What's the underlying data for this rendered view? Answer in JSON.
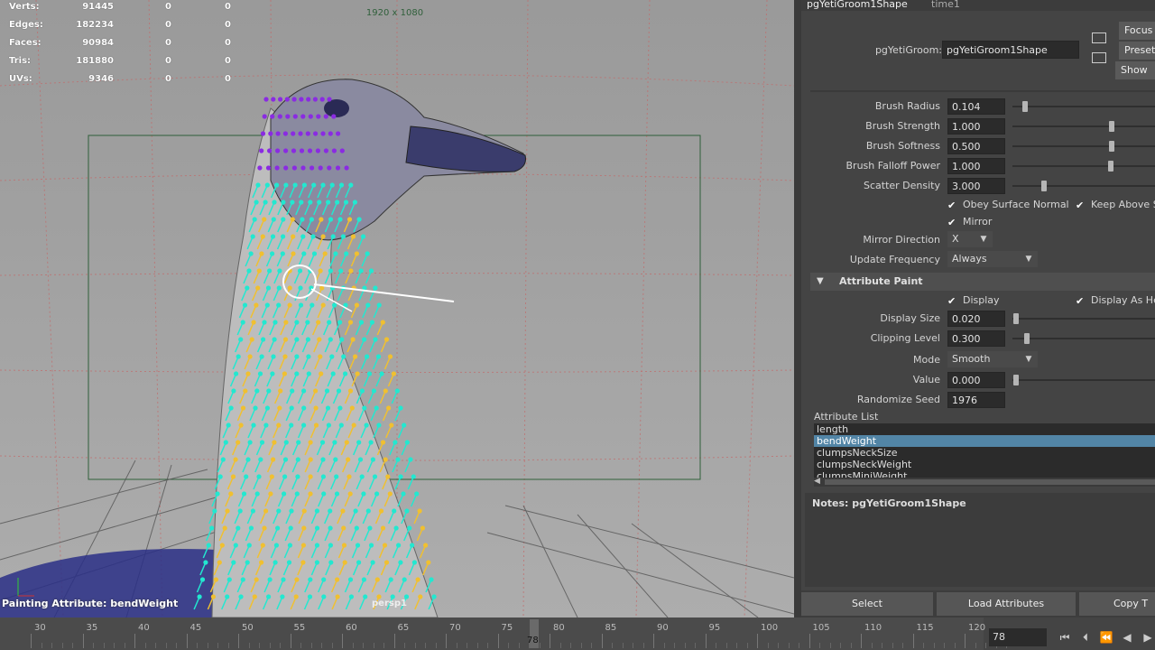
{
  "viewport": {
    "stats": [
      {
        "label": "Verts:",
        "v1": "91445",
        "v2": "0",
        "v3": "0"
      },
      {
        "label": "Edges:",
        "v1": "182234",
        "v2": "0",
        "v3": "0"
      },
      {
        "label": "Faces:",
        "v1": "90984",
        "v2": "0",
        "v3": "0"
      },
      {
        "label": "Tris:",
        "v1": "181880",
        "v2": "0",
        "v3": "0"
      },
      {
        "label": "UVs:",
        "v1": "9346",
        "v2": "0",
        "v3": "0"
      }
    ],
    "resolution": "1920 x 1080",
    "paint_status": "Painting Attribute: bendWeight",
    "camera": "persp1"
  },
  "panel": {
    "tabs": [
      "pgYetiGroom1Shape",
      "time1"
    ],
    "groom_label": "pgYetiGroom:",
    "groom_value": "pgYetiGroom1Shape",
    "side_buttons": [
      "Focus",
      "Presets",
      "Show"
    ],
    "brush": {
      "radius_label": "Brush Radius",
      "radius": "0.104",
      "strength_label": "Brush Strength",
      "strength": "1.000",
      "softness_label": "Brush Softness",
      "softness": "0.500",
      "falloff_label": "Brush Falloff Power",
      "falloff": "1.000",
      "scatter_label": "Scatter Density",
      "scatter": "3.000"
    },
    "obey_surface": "Obey Surface Normal",
    "keep_above": "Keep Above S",
    "mirror": "Mirror",
    "mirror_dir_label": "Mirror Direction",
    "mirror_dir": "X",
    "update_freq_label": "Update Frequency",
    "update_freq": "Always",
    "section_title": "Attribute Paint",
    "display": "Display",
    "display_as": "Display As He",
    "display_size_label": "Display Size",
    "display_size": "0.020",
    "clipping_label": "Clipping Level",
    "clipping": "0.300",
    "mode_label": "Mode",
    "mode": "Smooth",
    "value_label": "Value",
    "value": "0.000",
    "seed_label": "Randomize Seed",
    "seed": "1976",
    "attr_list_label": "Attribute List",
    "attr_list": [
      "length",
      "bendWeight",
      "clumpsNeckSize",
      "clumpsNeckWeight",
      "clumpsMiniWeight"
    ],
    "notes_label": "Notes:",
    "notes_value": "pgYetiGroom1Shape",
    "buttons": [
      "Select",
      "Load Attributes",
      "Copy T"
    ]
  },
  "timeline": {
    "ticks": [
      "30",
      "35",
      "40",
      "45",
      "50",
      "55",
      "60",
      "65",
      "70",
      "75",
      "80",
      "85",
      "90",
      "95",
      "100",
      "105",
      "110",
      "115",
      "120"
    ],
    "current_frame": "78",
    "frame_field": "78",
    "playback_icons": [
      "go-to-start-icon",
      "step-back-icon",
      "step-back-key-icon",
      "play-back-icon",
      "play-forward-icon"
    ]
  },
  "colors": {
    "accent": "#5285a6",
    "paint_purple": "#8a2be2",
    "paint_cyan": "#22e8d0",
    "paint_yellow": "#f0c030"
  }
}
